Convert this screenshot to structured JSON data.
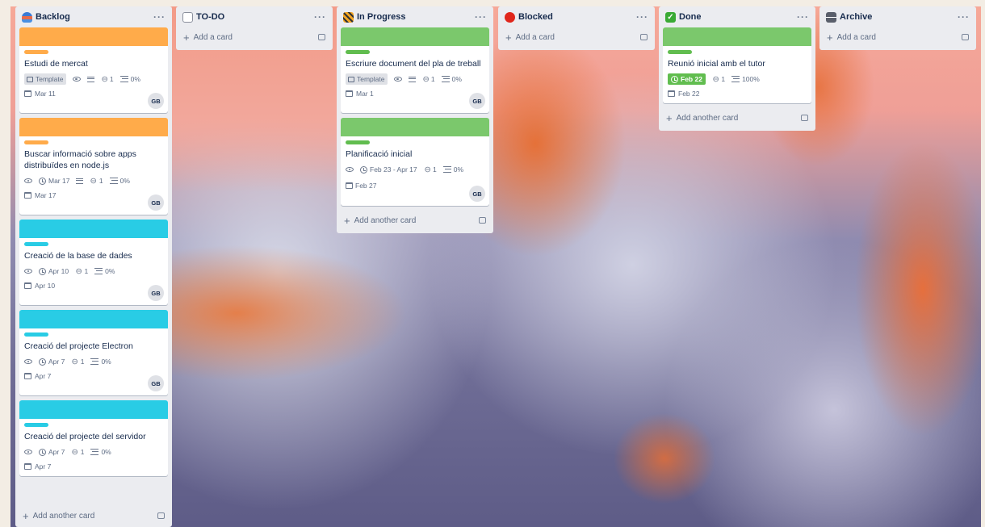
{
  "lists": {
    "backlog": {
      "title": "Backlog",
      "more": "···",
      "add_another": "Add another card",
      "cards": [
        {
          "cover": "#ffab4a",
          "label": "#ffab4a",
          "title": "Estudi de mercat",
          "template": "Template",
          "attachments": "1",
          "checklist": "0%",
          "date": "Mar 11",
          "avatar": "GB"
        },
        {
          "cover": "#ffab4a",
          "label": "#ffab4a",
          "title": "Buscar informació sobre apps distribuïdes en node.js",
          "due": "Mar 17",
          "attachments": "1",
          "checklist": "0%",
          "date": "Mar 17",
          "avatar": "GB"
        },
        {
          "cover": "#29cce5",
          "label": "#29cce5",
          "title": "Creació de la base de dades",
          "due": "Apr 10",
          "attachments": "1",
          "checklist": "0%",
          "date": "Apr 10",
          "avatar": "GB"
        },
        {
          "cover": "#29cce5",
          "label": "#29cce5",
          "title": "Creació del projecte Electron",
          "due": "Apr 7",
          "attachments": "1",
          "checklist": "0%",
          "date": "Apr 7",
          "avatar": "GB"
        },
        {
          "cover": "#29cce5",
          "label": "#29cce5",
          "title": "Creació del projecte del servidor",
          "due": "Apr 7",
          "attachments": "1",
          "checklist": "0%",
          "date": "Apr 7"
        }
      ]
    },
    "todo": {
      "title": "TO-DO",
      "more": "···",
      "add_card": "Add a card"
    },
    "in_progress": {
      "title": "In Progress",
      "more": "···",
      "add_another": "Add another card",
      "cards": [
        {
          "cover": "#7bc86c",
          "label": "#61bd4f",
          "title": "Escriure document del pla de treball",
          "template": "Template",
          "attachments": "1",
          "checklist": "0%",
          "date": "Mar 1",
          "avatar": "GB"
        },
        {
          "cover": "#7bc86c",
          "label": "#61bd4f",
          "title": "Planificació inicial",
          "due": "Feb 23 - Apr 17",
          "attachments": "1",
          "checklist": "0%",
          "start": "Feb 27",
          "avatar": "GB"
        }
      ]
    },
    "blocked": {
      "title": "Blocked",
      "more": "···",
      "add_card": "Add a card"
    },
    "done": {
      "title": "Done",
      "more": "···",
      "add_another": "Add another card",
      "cards": [
        {
          "cover": "#7bc86c",
          "label": "#61bd4f",
          "title": "Reunió inicial amb el tutor",
          "due_done": "Feb 22",
          "attachments": "1",
          "checklist": "100%",
          "date": "Feb 22"
        }
      ]
    },
    "archive": {
      "title": "Archive",
      "more": "···",
      "add_card": "Add a card"
    }
  },
  "icons": {
    "backlog": "stack-icon",
    "todo": "memo-icon",
    "in_progress": "construction-icon",
    "blocked": "red-circle-icon",
    "done": "check-box-icon",
    "archive": "file-cabinet-icon"
  },
  "colors": {
    "due_complete": "#61bd4f",
    "list_bg": "#ebecf0"
  }
}
